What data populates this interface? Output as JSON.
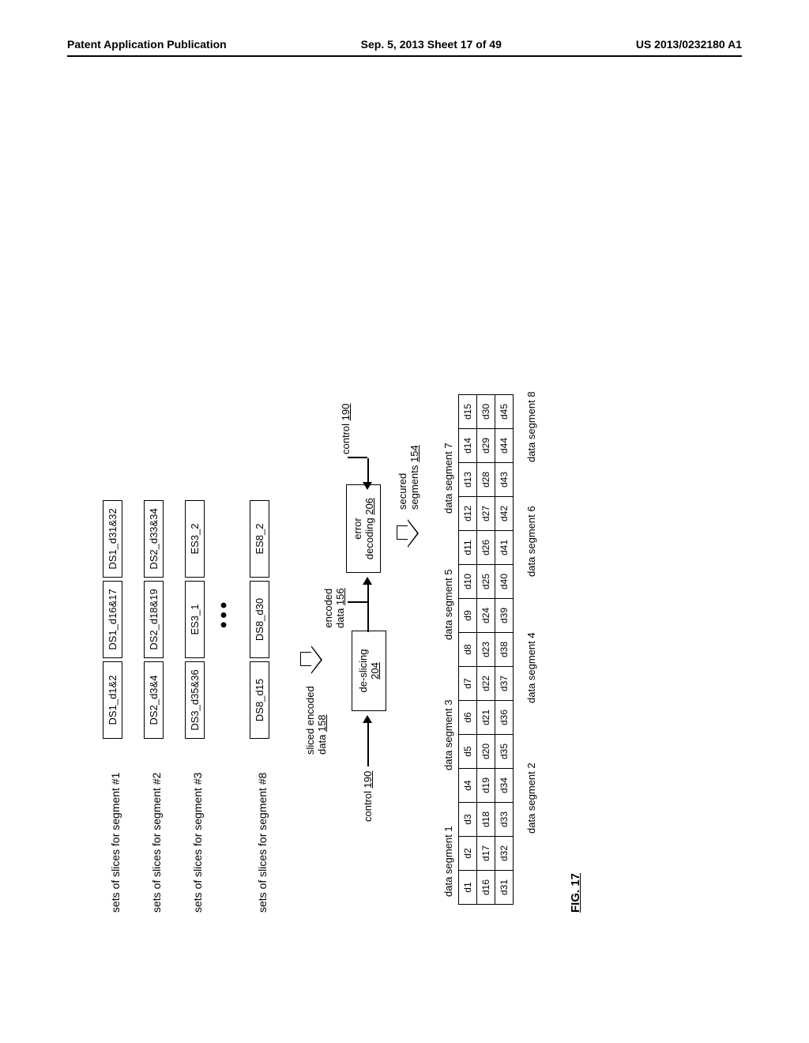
{
  "header": {
    "left": "Patent Application Publication",
    "center": "Sep. 5, 2013  Sheet 17 of 49",
    "right": "US 2013/0232180 A1"
  },
  "slices": {
    "rows": [
      {
        "label": "sets of slices for segment #1",
        "cells": [
          "DS1_d1&2",
          "DS1_d16&17",
          "DS1_d31&32"
        ]
      },
      {
        "label": "sets of slices for segment #2",
        "cells": [
          "DS2_d3&4",
          "DS2_d18&19",
          "DS2_d33&34"
        ]
      },
      {
        "label": "sets of slices for segment #3",
        "cells": [
          "DS3_d35&36",
          "ES3_1",
          "ES3_2"
        ]
      },
      {
        "label": "sets of slices for segment #8",
        "cells": [
          "DS8_d15",
          "DS8_d30",
          "ES8_2"
        ]
      }
    ]
  },
  "flow": {
    "sliced_encoded": "sliced encoded",
    "data158": "data",
    "data158_num": "158",
    "control_left": "control",
    "control_left_num": "190",
    "control_right": "control",
    "control_right_num": "190",
    "deslicing": "de-slicing",
    "deslicing_num": "204",
    "encoded": "encoded",
    "data156": "data",
    "data156_num": "156",
    "error_decoding": "error",
    "error_decoding2": "decoding",
    "error_decoding_num": "206",
    "secured": "secured",
    "segments": "segments",
    "segments_num": "154"
  },
  "segments": {
    "labels_top": [
      "data segment 1",
      "data segment 3",
      "data segment 5",
      "data segment 7"
    ],
    "labels_bot": [
      "data segment 2",
      "data segment 4",
      "data segment 6",
      "data segment 8"
    ],
    "cells": [
      [
        "d1",
        "d2",
        "d3",
        "d4",
        "d5",
        "d6",
        "d7",
        "d8",
        "d9",
        "d10",
        "d11",
        "d12",
        "d13",
        "d14",
        "d15"
      ],
      [
        "d16",
        "d17",
        "d18",
        "d19",
        "d20",
        "d21",
        "d22",
        "d23",
        "d24",
        "d25",
        "d26",
        "d27",
        "d28",
        "d29",
        "d30"
      ],
      [
        "d31",
        "d32",
        "d33",
        "d34",
        "d35",
        "d36",
        "d37",
        "d38",
        "d39",
        "d40",
        "d41",
        "d42",
        "d43",
        "d44",
        "d45"
      ]
    ]
  },
  "fig": "FIG. 17"
}
